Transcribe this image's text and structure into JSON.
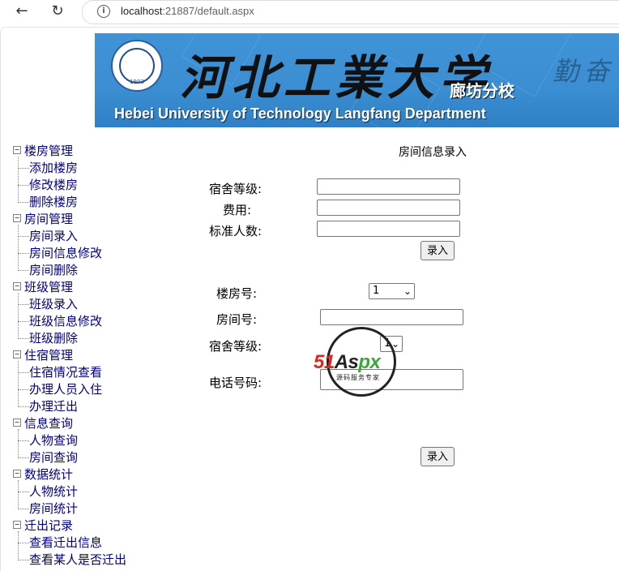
{
  "browser": {
    "url_host": "localhost",
    "url_rest": ":21887/default.aspx",
    "back_icon": "arrow-left-icon",
    "reload_icon": "reload-icon",
    "info_icon": "info-icon"
  },
  "banner": {
    "university_cn": "河北工業大学",
    "campus_cn": "廊坊分校",
    "university_en": "Hebei University of Technology Langfang Department",
    "motto": "勤奋",
    "seal_year": "1903",
    "colors": {
      "background": "#3b8ed1",
      "text_en": "#ffffff"
    }
  },
  "tree": {
    "expand_glyph": "⊟",
    "groups": [
      {
        "label": "楼房管理",
        "items": [
          "添加楼房",
          "修改楼房",
          "删除楼房"
        ]
      },
      {
        "label": "房间管理",
        "items": [
          "房间录入",
          "房间信息修改",
          "房间删除"
        ]
      },
      {
        "label": "班级管理",
        "items": [
          "班级录入",
          "班级信息修改",
          "班级删除"
        ]
      },
      {
        "label": "住宿管理",
        "items": [
          "住宿情况查看",
          "办理人员入住",
          "办理迁出"
        ]
      },
      {
        "label": "信息查询",
        "items": [
          "人物查询",
          "房间查询"
        ]
      },
      {
        "label": "数据统计",
        "items": [
          "人物统计",
          "房间统计"
        ]
      },
      {
        "label": "迁出记录",
        "items": [
          "查看迁出信息",
          "查看某人是否迁出"
        ]
      }
    ],
    "link_color": "#000080"
  },
  "form": {
    "title": "房间信息录入",
    "section1": {
      "dorm_level_label": "宿舍等级:",
      "fee_label": "费用:",
      "capacity_label": "标准人数:",
      "submit_label": "录入"
    },
    "section2": {
      "building_label": "楼房号:",
      "building_value": "1",
      "room_label": "房间号:",
      "dorm_level_label": "宿舍等级:",
      "dorm_level_value": "1",
      "phone_label": "电话号码:",
      "submit_label": "录入"
    }
  },
  "watermark": {
    "brand_a": "51",
    "brand_b": "As",
    "brand_c": "px",
    "subtitle": "源码服务专家"
  }
}
